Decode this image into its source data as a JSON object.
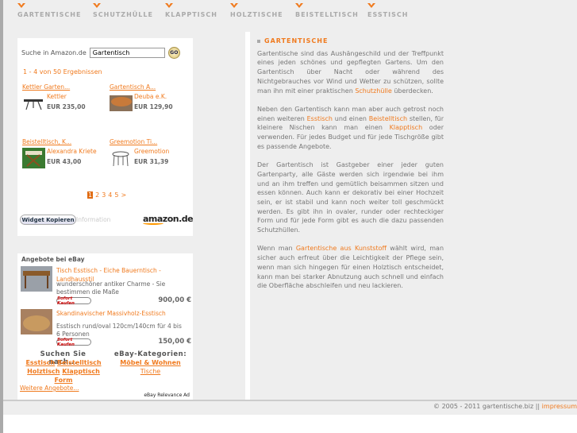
{
  "nav": [
    {
      "label": "GARTENTISCHE"
    },
    {
      "label": "SCHUTZHÜLLE"
    },
    {
      "label": "KLAPPTISCH"
    },
    {
      "label": "HOLZTISCHE"
    },
    {
      "label": "BEISTELLTISCH"
    },
    {
      "label": "ESSTISCH"
    }
  ],
  "amazon": {
    "search_label": "Suche in Amazon.de",
    "search_value": "Gartentisch",
    "go": "GO",
    "results": "1 - 4 von 50 Ergebnissen",
    "products": [
      {
        "title": "Kettler Garten...",
        "seller": "Kettler",
        "price": "EUR 235,00"
      },
      {
        "title": "Gartentisch A...",
        "seller": "Deuba e.K.",
        "price": "EUR 129,90"
      },
      {
        "title": "Beistelltisch, K...",
        "seller": "Alexandra Kriete",
        "price": "EUR 43,00"
      },
      {
        "title": "Greemotion Ti...",
        "seller": "Greemotion",
        "price": "EUR 31,39"
      }
    ],
    "pages": [
      "1",
      "2",
      "3",
      "4",
      "5",
      ">"
    ],
    "widget_button": "Widget Kopieren",
    "information": "Information",
    "logo": "amazon.de"
  },
  "ebay": {
    "heading": "Angebote bei eBay",
    "items": [
      {
        "title": "Tisch Esstisch - Eiche Bauerntisch - Landhausstil",
        "desc": "wunderschöner antiker Charme - Sie bestimmen die Maße",
        "badge": "Sofort Kaufen",
        "price": "900,00 €"
      },
      {
        "title": "Skandinavischer Massivholz-Esstisch",
        "desc": "Esstisch rund/oval 120cm/140cm für 4 bis 6 Personen",
        "badge": "Sofort Kaufen",
        "price": "150,00 €"
      }
    ],
    "search_heading": "Suchen Sie nach...",
    "search_links": [
      "Esstisch",
      "Beistelltisch",
      "Holztisch",
      "Klapptisch",
      "Form"
    ],
    "cat_heading": "eBay-Kategorien:",
    "cat_links": [
      "Möbel & Wohnen",
      "Tische"
    ],
    "more": "Weitere Angebote...",
    "relevance": "eBay Relevance Ad"
  },
  "content": {
    "title": "GARTENTISCHE",
    "paragraphs": [
      [
        {
          "t": "Gartentische sind das Aushängeschild und der Treffpunkt eines jeden schönes und gepflegten Gartens. Um den Gartentisch über Nacht oder während des Nichtgebrauches vor Wind und Wetter zu schützen, sollte man ihn mit einer praktischen "
        },
        {
          "l": "Schutzhülle"
        },
        {
          "t": " überdecken."
        }
      ],
      [
        {
          "t": "Neben den Gartentisch kann man aber auch getrost noch einen weiteren "
        },
        {
          "l": "Esstisch"
        },
        {
          "t": " und einen "
        },
        {
          "l": "Beistelltisch"
        },
        {
          "t": " stellen, für kleinere Nischen kann man einen "
        },
        {
          "l": "Klapptisch"
        },
        {
          "t": " oder verwenden. Für jedes Budget und für jede Tischgröße gibt es passende Angebote."
        }
      ],
      [
        {
          "t": "Der Gartentisch ist Gastgeber einer jeder guten Gartenparty, alle Gäste werden sich irgendwie bei ihm und an ihm treffen und gemütlich beisammen sitzen und essen können. Auch kann er dekorativ bei einer Hochzeit sein, er ist stabil und kann noch weiter toll geschmückt werden. Es gibt ihn in ovaler, runder oder rechteckiger Form und für jede Form gibt es auch die dazu passenden Schutzhüllen."
        }
      ],
      [
        {
          "t": "Wenn man "
        },
        {
          "l": "Gartentische aus Kunststoff"
        },
        {
          "t": " wählt wird, man sicher auch erfreut über die Leichtigkeit der Pflege sein, wenn man sich hingegen für einen Holztisch entscheidet, kann man bei starker Abnutzung auch schnell und einfach die Oberfläche abschleifen und neu lackieren."
        }
      ]
    ]
  },
  "footer": {
    "copyright": "© 2005 - 2011 gartentische.biz || ",
    "impressum": "impressum"
  }
}
